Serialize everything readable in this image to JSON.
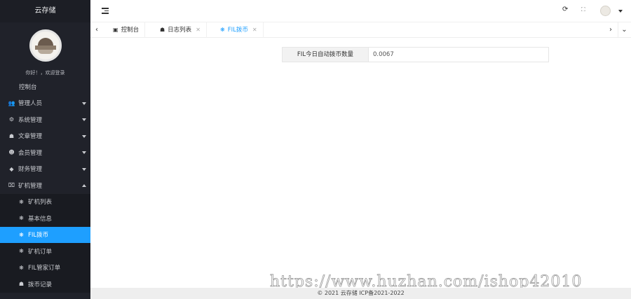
{
  "brand": "云存储",
  "user": {
    "welcome": "你好！，欢迎登录"
  },
  "sidebar": {
    "items": [
      {
        "label": "控制台",
        "icon": "none"
      },
      {
        "label": "管理人员",
        "icon": "users-icon"
      },
      {
        "label": "系统管理",
        "icon": "gear-icon"
      },
      {
        "label": "文章管理",
        "icon": "book-icon"
      },
      {
        "label": "会员管理",
        "icon": "user-icon"
      },
      {
        "label": "财务管理",
        "icon": "diamond-icon"
      },
      {
        "label": "矿机管理",
        "icon": "cart-icon"
      },
      {
        "label": "矿机列表",
        "icon": "cube-icon"
      },
      {
        "label": "基本信息",
        "icon": "cube-icon"
      },
      {
        "label": "FIL拨币",
        "icon": "cube-icon"
      },
      {
        "label": "矿机订单",
        "icon": "cube-icon"
      },
      {
        "label": "FIL管家订单",
        "icon": "cube-icon"
      },
      {
        "label": "拨币记录",
        "icon": "cube-icon"
      }
    ]
  },
  "tabs": [
    {
      "label": "控制台",
      "icon": "monitor-icon"
    },
    {
      "label": "日志列表",
      "icon": "book-icon"
    },
    {
      "label": "FIL拨币",
      "icon": "cube-icon"
    }
  ],
  "content": {
    "label": "FIL今日自动拨币数量",
    "value": "0.0067"
  },
  "watermark": "https://www.huzhan.com/ishop42010",
  "footer": "© 2021 云存储 ICP备2021-2022",
  "colors": {
    "accent": "#1e9fff",
    "sidebar": "#20222a"
  }
}
